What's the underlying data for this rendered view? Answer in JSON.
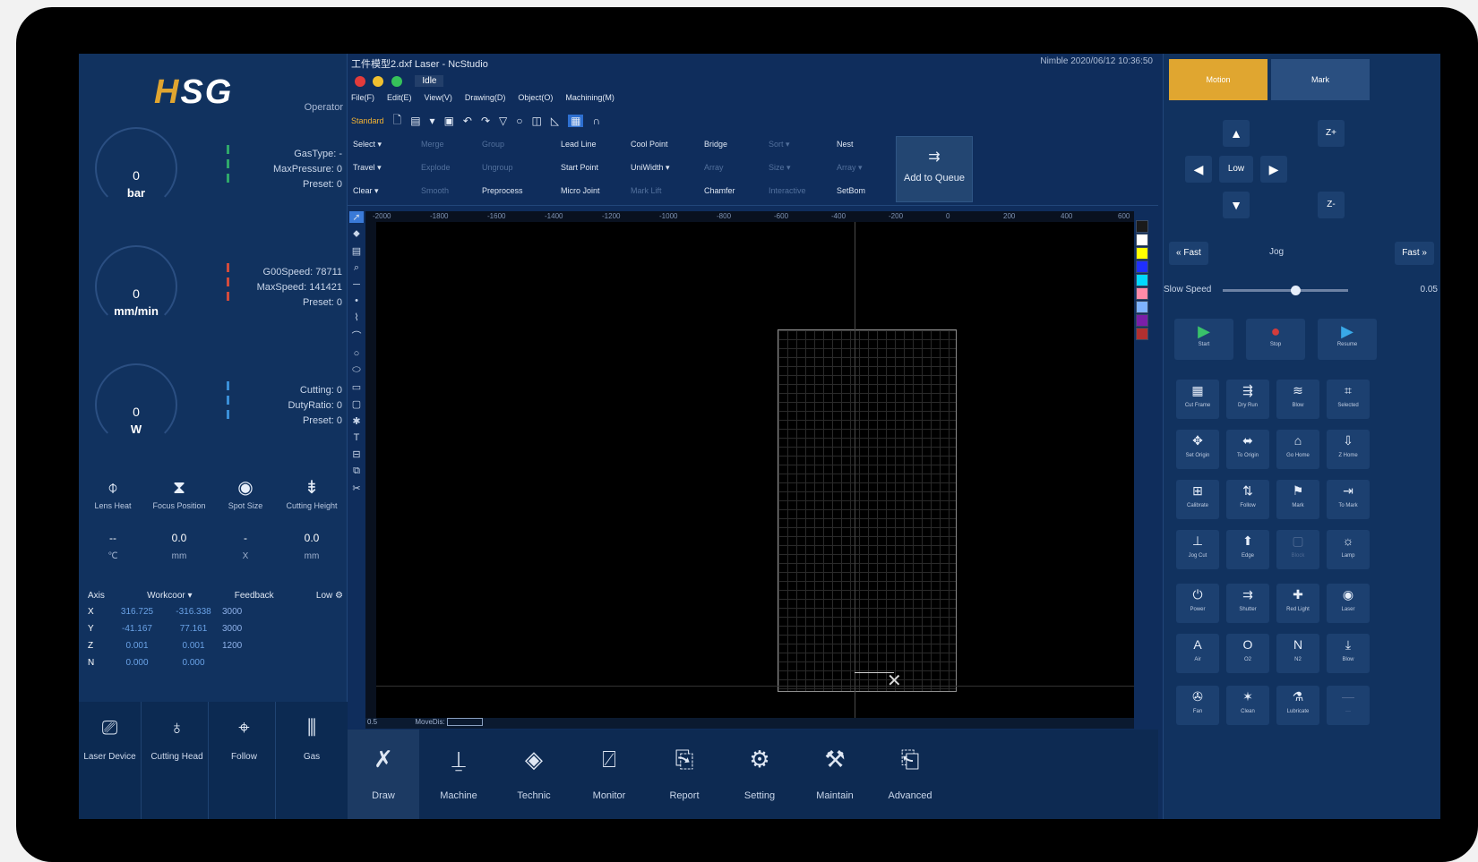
{
  "branding": {
    "logo": "HSG",
    "role": "Operator"
  },
  "gauges": [
    {
      "value": "0",
      "unit": "bar",
      "info": [
        "GasType: -",
        "MaxPressure: 0",
        "Preset: 0"
      ],
      "bar_color": "#2fa86a"
    },
    {
      "value": "0",
      "unit": "mm/min",
      "info": [
        "G00Speed: 78711",
        "MaxSpeed: 141421",
        "Preset: 0"
      ],
      "bar_color": "#d24b3c"
    },
    {
      "value": "0",
      "unit": "W",
      "info": [
        "Cutting: 0",
        "DutyRatio: 0",
        "Preset: 0"
      ],
      "bar_color": "#3a8fd8"
    }
  ],
  "head_tools": [
    {
      "icon": "lens-heat-icon",
      "label": "Lens Heat",
      "value": "--",
      "unit": "℃"
    },
    {
      "icon": "focus-position-icon",
      "label": "Focus Position",
      "value": "0.0",
      "unit": "mm"
    },
    {
      "icon": "spot-size-icon",
      "label": "Spot Size",
      "value": "-",
      "unit": "X"
    },
    {
      "icon": "cutting-height-icon",
      "label": "Cutting Height",
      "value": "0.0",
      "unit": "mm"
    }
  ],
  "axis_table": {
    "headers": [
      "Axis",
      "Workcoor ▾",
      "Feedback",
      "Low ⚙"
    ],
    "rows": [
      {
        "axis": "X",
        "workcoor": "316.725",
        "feedback": "-316.338",
        "speed": "3000"
      },
      {
        "axis": "Y",
        "workcoor": "-41.167",
        "feedback": "77.161",
        "speed": "3000"
      },
      {
        "axis": "Z",
        "workcoor": "0.001",
        "feedback": "0.001",
        "speed": "1200"
      },
      {
        "axis": "N",
        "workcoor": "0.000",
        "feedback": "0.000",
        "speed": ""
      }
    ]
  },
  "devices": [
    {
      "icon": "laser-device-icon",
      "label": "Laser Device"
    },
    {
      "icon": "cutting-head-icon",
      "label": "Cutting Head"
    },
    {
      "icon": "follow-icon",
      "label": "Follow"
    },
    {
      "icon": "gas-icon",
      "label": "Gas"
    }
  ],
  "window": {
    "title": "工件模型2.dxf Laser - NcStudio",
    "status": "Nimble 2020/06/12 10:36:50",
    "state": "Idle"
  },
  "menu": [
    "File(F)",
    "Edit(E)",
    "View(V)",
    "Drawing(D)",
    "Object(O)",
    "Machining(M)"
  ],
  "quick": {
    "label": "Standard"
  },
  "ribbon": {
    "select": "Select ▾",
    "travel": "Travel ▾",
    "clear": "Clear ▾",
    "merge": "Merge",
    "explode": "Explode",
    "smooth": "Smooth",
    "group": "Group",
    "ungroup": "Ungroup",
    "preprocess": "Preprocess",
    "leadline": "Lead Line",
    "startpoint": "Start Point",
    "micro_joint": "Micro Joint",
    "cool_point": "Cool Point",
    "uniform": "UniWidth ▾",
    "mark_lift": "Mark Lift",
    "bridge": "Bridge",
    "array": "Array",
    "chamfer": "Chamfer",
    "sort": "Sort ▾",
    "size": "Size ▾",
    "interactive": "Interactive",
    "nest": "Nest",
    "array2": "Array ▾",
    "setbom": "SetBom",
    "add_queue": "Add to Queue"
  },
  "ruler": [
    "-2000",
    "-1800",
    "-1600",
    "-1400",
    "-1200",
    "-1000",
    "-800",
    "-600",
    "-400",
    "-200",
    "0",
    "200",
    "400",
    "600"
  ],
  "palette": [
    "#000000",
    "#ffffff",
    "#ffff00",
    "#1f2fff",
    "#00d9ff",
    "#ff8ba8",
    "#7fb3ff",
    "#7a1fa8",
    "#b03030"
  ],
  "canvas_status": {
    "left": "0.5",
    "mode": "MoveDis:"
  },
  "bottom_nav": [
    {
      "icon": "draw-icon",
      "label": "Draw",
      "active": true
    },
    {
      "icon": "machine-icon",
      "label": "Machine"
    },
    {
      "icon": "technic-icon",
      "label": "Technic"
    },
    {
      "icon": "monitor-icon",
      "label": "Monitor"
    },
    {
      "icon": "report-icon",
      "label": "Report"
    },
    {
      "icon": "setting-icon",
      "label": "Setting"
    },
    {
      "icon": "maintain-icon",
      "label": "Maintain"
    },
    {
      "icon": "advanced-icon",
      "label": "Advanced"
    }
  ],
  "right": {
    "tab_motion": "Motion",
    "tab_mark": "Mark",
    "z_up": "Z+",
    "z_down": "Z-",
    "low": "Low",
    "fast_left": "« Fast",
    "step": "Jog",
    "fast_right": "Fast »",
    "slow_label": "Slow Speed",
    "slow_value": "0.05",
    "slider_fraction": 0.58,
    "run_buttons": [
      {
        "label": "Start",
        "color": "#39c26a"
      },
      {
        "label": "Stop",
        "color": "#d23c3c"
      },
      {
        "label": "Resume",
        "color": "#39a9e8"
      }
    ],
    "grid": [
      [
        "Cut Frame",
        "Dry Run",
        "Blow",
        "Selected"
      ],
      [
        "Set Origin",
        "To Origin",
        "Go Home",
        "Z Home"
      ],
      [
        "Calibrate",
        "Follow",
        "Mark",
        "To Mark"
      ],
      [
        "Jog Cut",
        "Edge",
        "Block",
        "Lamp"
      ],
      [
        "Power",
        "Shutter",
        "Red Light",
        "Laser"
      ],
      [
        "Air",
        "O2",
        "N2",
        "Blow"
      ],
      [
        "Fan",
        "Clean",
        "Lubricate",
        "—"
      ]
    ]
  }
}
